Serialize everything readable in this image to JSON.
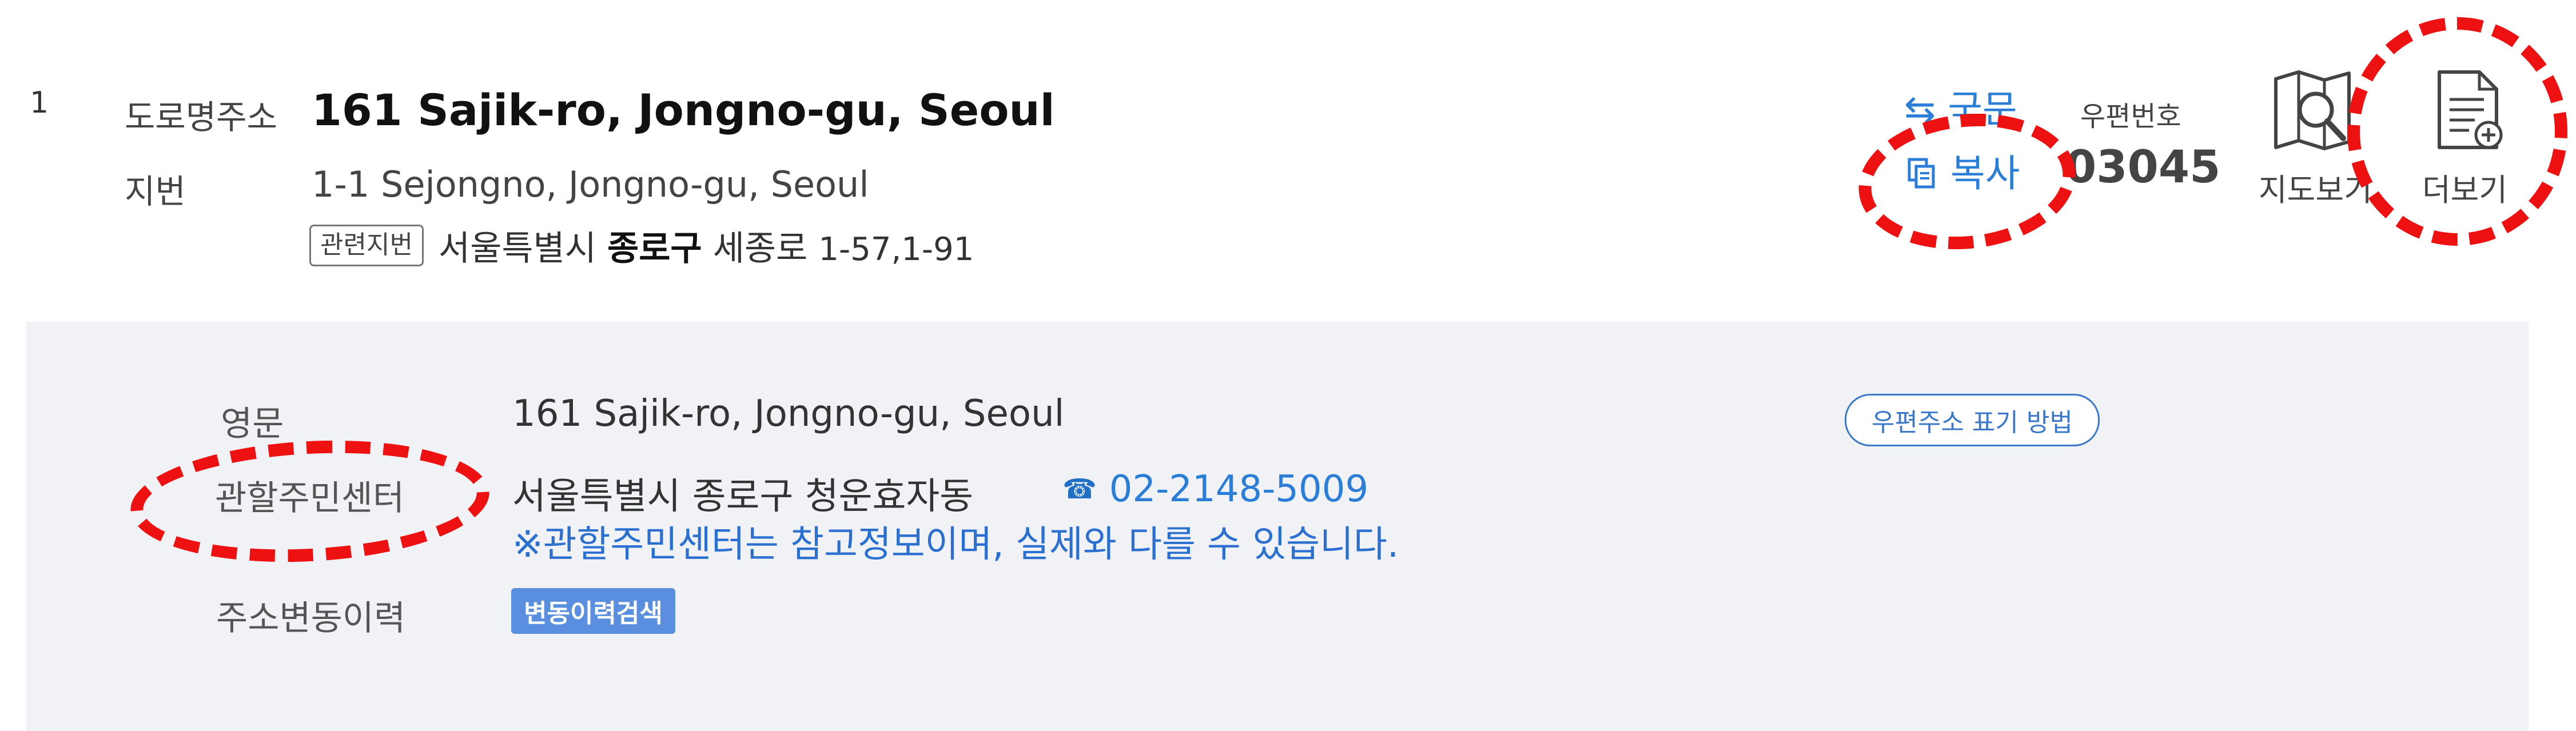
{
  "result": {
    "index": "1",
    "road_label": "도로명주소",
    "road_address": "161 Sajik-ro, Jongno-gu, Seoul",
    "jibun_label": "지번",
    "jibun_address": "1-1 Sejongno, Jongno-gu, Seoul",
    "related": {
      "badge": "관련지번",
      "city": "서울특별시",
      "district": "종로구",
      "road": "세종로",
      "numbers": "1-57,1-91"
    },
    "actions": {
      "korean_label": "국문",
      "copy_label": "복사",
      "postal_label": "우편번호",
      "postal_code": "03045",
      "map_label": "지도보기",
      "more_label": "더보기"
    }
  },
  "detail": {
    "english_label": "영문",
    "english_value": "161 Sajik-ro, Jongno-gu, Seoul",
    "center_label": "관할주민센터",
    "center_value": "서울특별시 종로구 청운효자동",
    "phone": "02-2148-5009",
    "notice": "※관할주민센터는 참고정보이며, 실제와 다를 수 있습니다.",
    "history_label": "주소변동이력",
    "history_button": "변동이력검색",
    "postal_method_button": "우편주소 표기 방법"
  },
  "colors": {
    "link": "#2b7ed8",
    "highlight": "#ee1111",
    "panel_bg": "#f0f2f5",
    "history_button_bg": "#5a8fe0"
  },
  "icons": {
    "korean": "arrow-left-icon",
    "copy": "copy-icon",
    "map": "map-icon",
    "more": "document-plus-icon",
    "phone": "phone-icon"
  }
}
